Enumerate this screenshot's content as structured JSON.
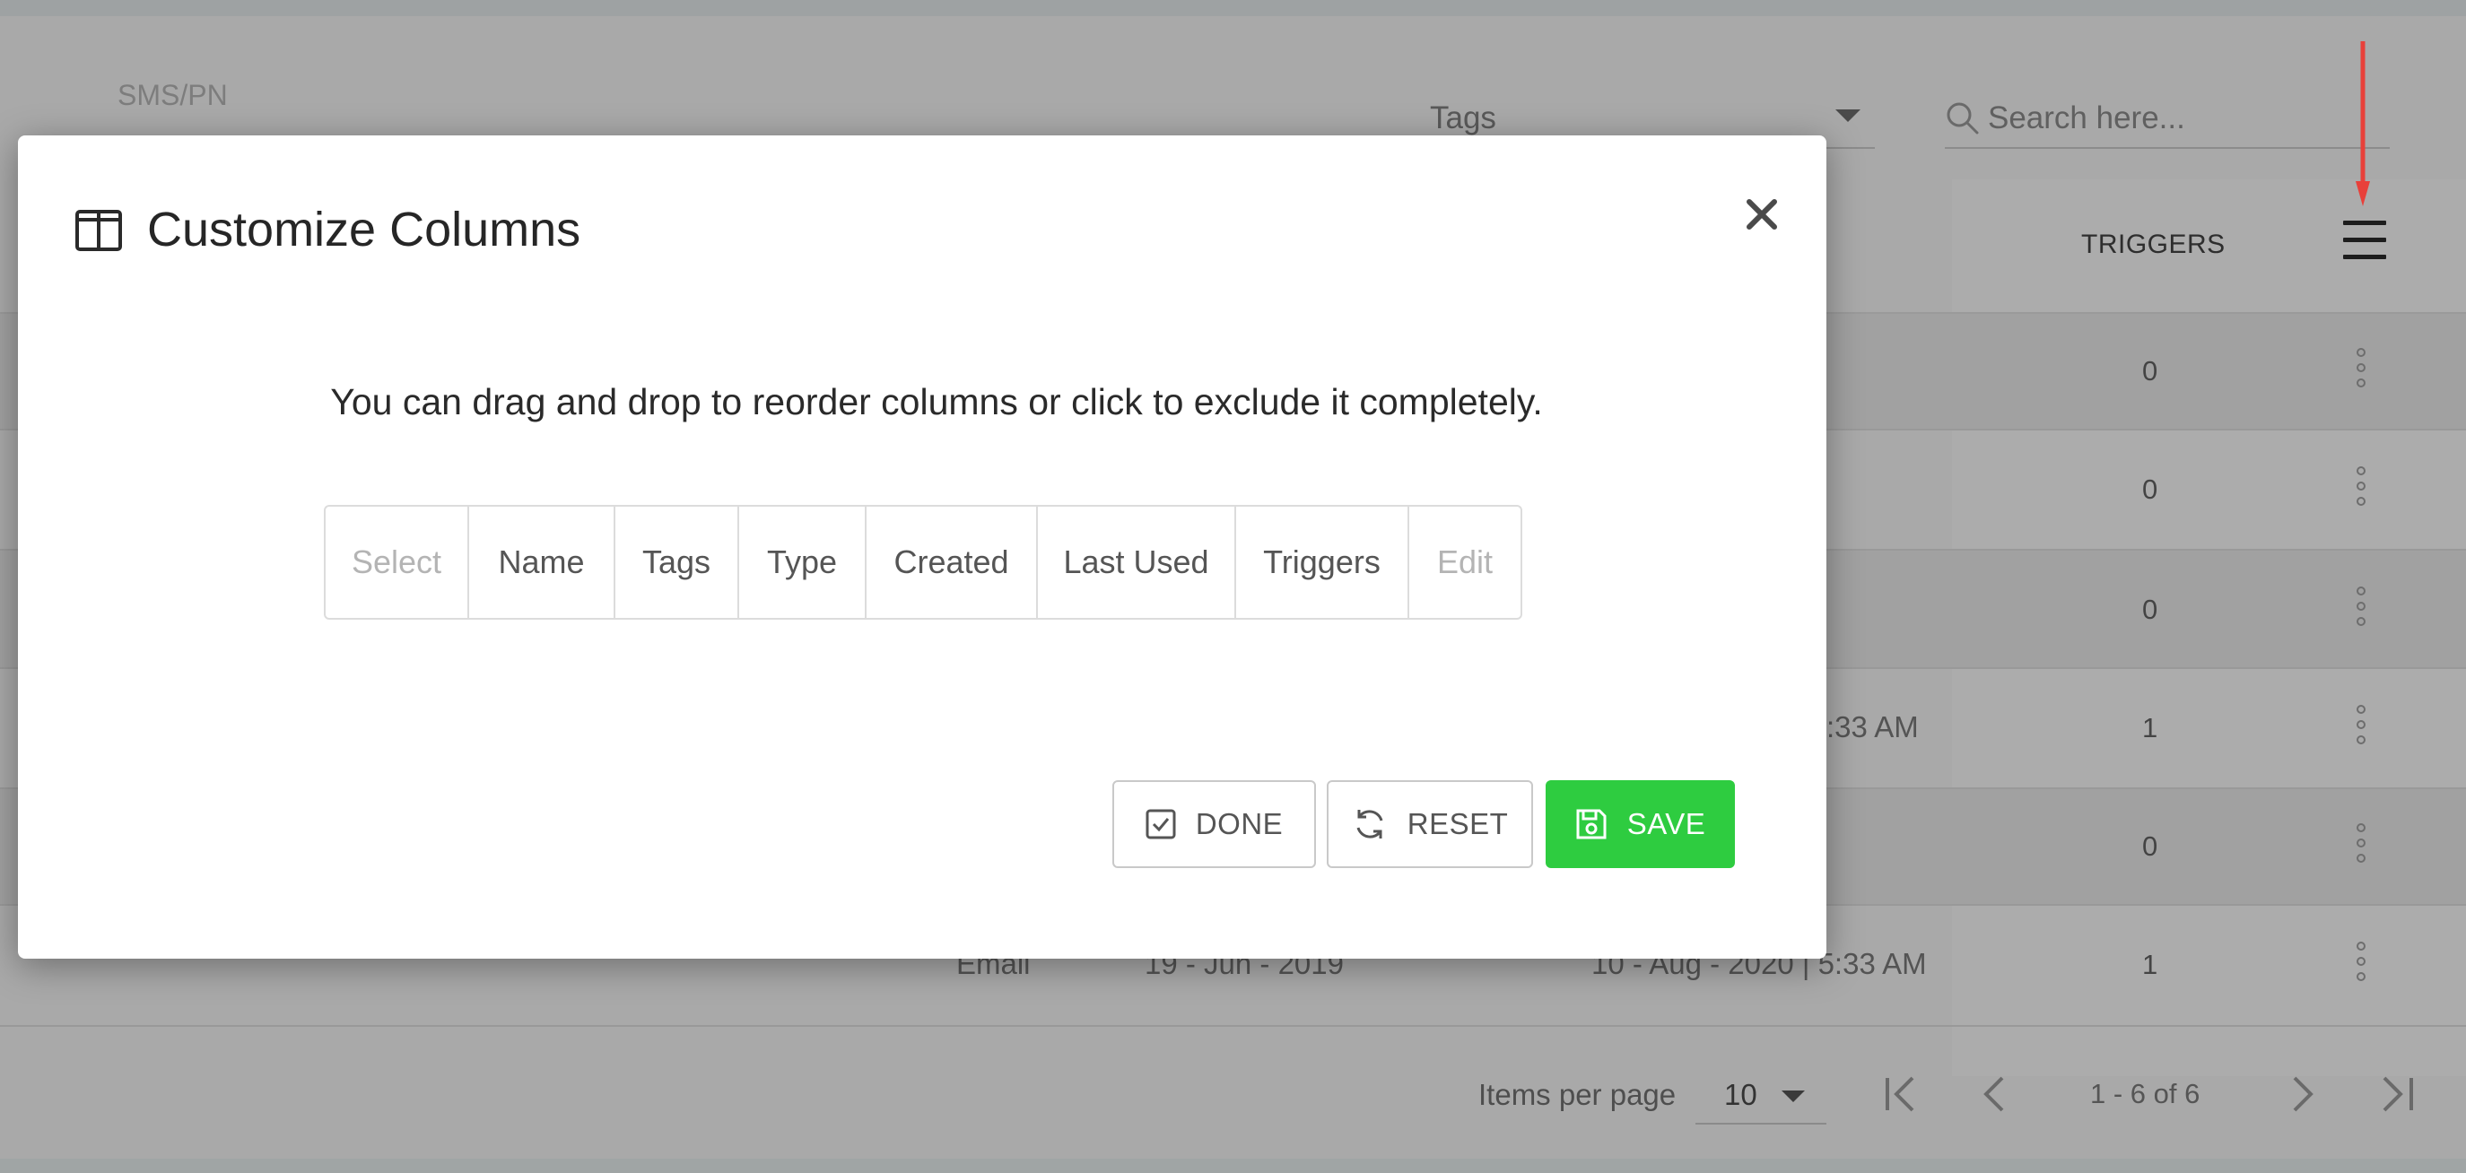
{
  "background": {
    "section_label": "SMS/PN",
    "tags_filter": {
      "label": "Tags"
    },
    "search": {
      "placeholder": "Search here..."
    },
    "table": {
      "triggers_header": "TRIGGERS",
      "rows": [
        {
          "type": "",
          "created": "",
          "last_used": "",
          "triggers": "0"
        },
        {
          "type": "",
          "created": "",
          "last_used": "",
          "triggers": "0"
        },
        {
          "type": "",
          "created": "",
          "last_used": "",
          "triggers": "0"
        },
        {
          "type": "",
          "created": "",
          "last_used": ":33 AM",
          "triggers": "1"
        },
        {
          "type": "",
          "created": "",
          "last_used": "",
          "triggers": "0"
        },
        {
          "type": "Email",
          "created": "19 - Jun - 2019",
          "last_used": "10 - Aug - 2020 | 5:33 AM",
          "triggers": "1"
        }
      ]
    },
    "pagination": {
      "items_per_page_label": "Items per page",
      "items_per_page_value": "10",
      "range": "1 - 6 of 6"
    }
  },
  "modal": {
    "title": "Customize Columns",
    "title_icon": "columns-icon",
    "instructions": "You can drag and drop to reorder columns or click to exclude it completely.",
    "columns": [
      {
        "label": "Select",
        "enabled": false
      },
      {
        "label": "Name",
        "enabled": true
      },
      {
        "label": "Tags",
        "enabled": true
      },
      {
        "label": "Type",
        "enabled": true
      },
      {
        "label": "Created",
        "enabled": true
      },
      {
        "label": "Last Used",
        "enabled": true
      },
      {
        "label": "Triggers",
        "enabled": true
      },
      {
        "label": "Edit",
        "enabled": false
      }
    ],
    "buttons": {
      "done": "DONE",
      "reset": "RESET",
      "save": "SAVE"
    }
  },
  "colors": {
    "save_green": "#2ecc40",
    "annotation_arrow": "#e8403a"
  }
}
